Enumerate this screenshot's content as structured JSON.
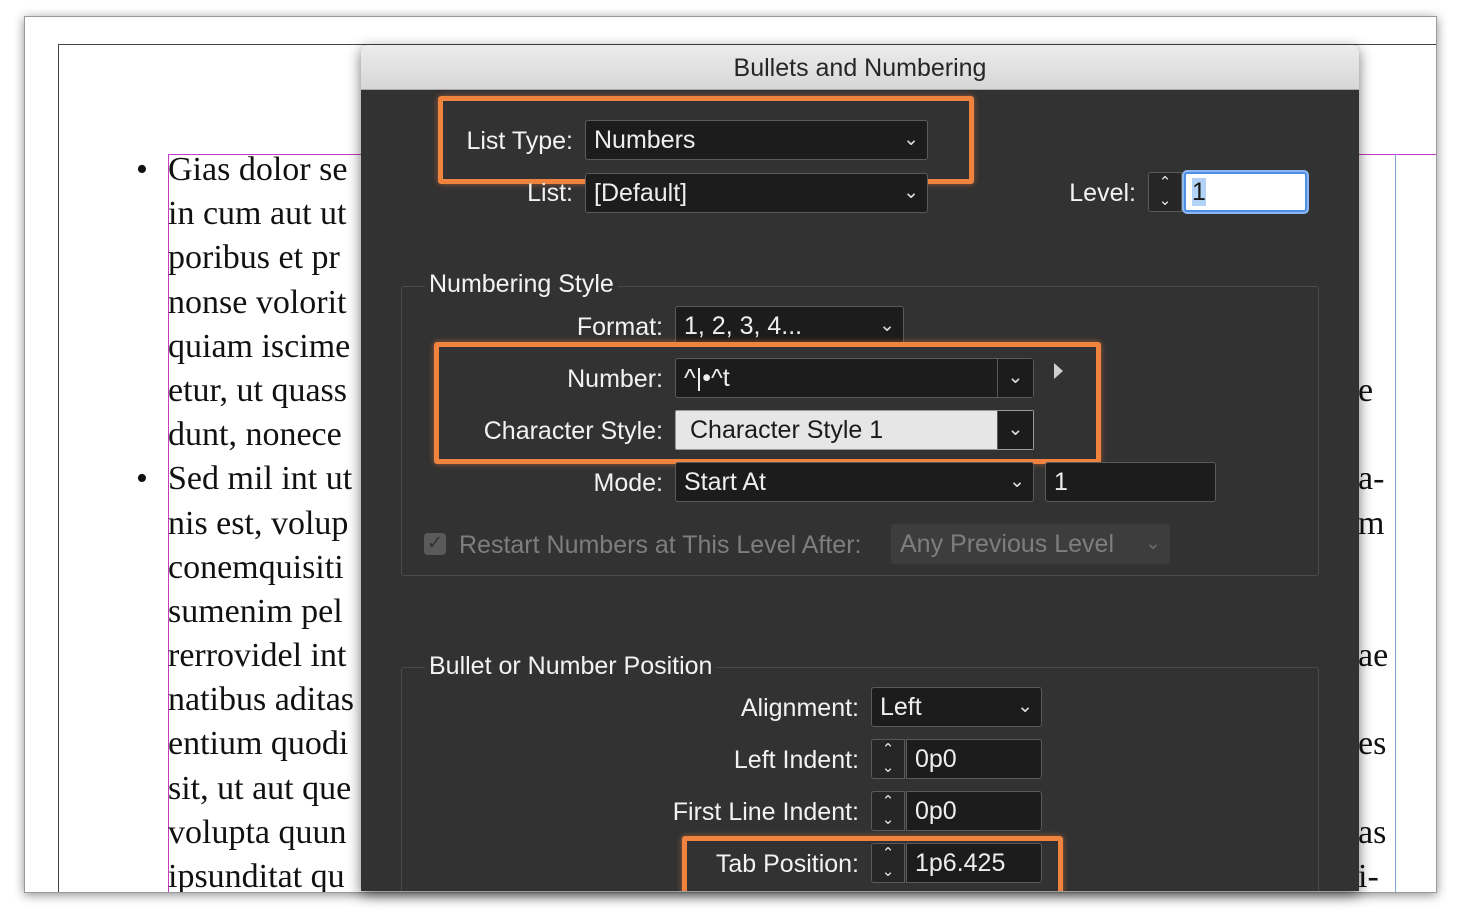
{
  "document": {
    "lines": [
      {
        "bullet": "•",
        "text": "Gias dolor se",
        "right": ""
      },
      {
        "bullet": "",
        "text": "in cum aut ut",
        "right": ""
      },
      {
        "bullet": "",
        "text": "poribus et pr",
        "right": ""
      },
      {
        "bullet": "",
        "text": "nonse volorit",
        "right": ""
      },
      {
        "bullet": "",
        "text": "quiam iscime",
        "right": ""
      },
      {
        "bullet": "",
        "text": "etur, ut quass",
        "right": "e"
      },
      {
        "bullet": "",
        "text": "dunt, nonece",
        "right": ""
      },
      {
        "bullet": "•",
        "text": "Sed mil int ut",
        "right": "a-"
      },
      {
        "bullet": "",
        "text": "nis est, volup",
        "right": "m"
      },
      {
        "bullet": "",
        "text": "conemquisiti",
        "right": ""
      },
      {
        "bullet": "",
        "text": "sumenim pel",
        "right": ""
      },
      {
        "bullet": "",
        "text": "rerrovidel int",
        "right": "ae"
      },
      {
        "bullet": "",
        "text": "natibus aditas",
        "right": ""
      },
      {
        "bullet": "",
        "text": "entium quodi",
        "right": "es"
      },
      {
        "bullet": "",
        "text": "sit, ut aut que",
        "right": ""
      },
      {
        "bullet": "",
        "text": "volupta quun",
        "right": "as"
      },
      {
        "bullet": "",
        "text": "ipsunditat qu",
        "right": "i-"
      }
    ]
  },
  "dialog": {
    "title": "Bullets and Numbering",
    "list_type": {
      "label": "List Type:",
      "value": "Numbers"
    },
    "list": {
      "label": "List:",
      "value": "[Default]"
    },
    "level": {
      "label": "Level:",
      "value": "1"
    },
    "numbering_style": {
      "title": "Numbering Style",
      "format": {
        "label": "Format:",
        "value": "1, 2, 3, 4..."
      },
      "number": {
        "label": "Number:",
        "value": "^|•^t"
      },
      "character_style": {
        "label": "Character Style:",
        "value": "Character Style 1"
      },
      "mode": {
        "label": "Mode:",
        "value": "Start At",
        "start_value": "1"
      },
      "restart": {
        "label": "Restart Numbers at This Level After:",
        "value": "Any Previous Level",
        "checked": true
      }
    },
    "position": {
      "title": "Bullet or Number Position",
      "alignment": {
        "label": "Alignment:",
        "value": "Left"
      },
      "left_indent": {
        "label": "Left Indent:",
        "value": "0p0"
      },
      "first_line_indent": {
        "label": "First Line Indent:",
        "value": "0p0"
      },
      "tab_position": {
        "label": "Tab Position:",
        "value": "1p6.425"
      }
    }
  },
  "colors": {
    "highlight": "#f0843f",
    "dialog_bg": "#323232",
    "focus": "#4d90e4"
  },
  "icons": {
    "dropdown": "chevron-down-icon",
    "stepper": "stepper-icon",
    "flyout": "triangle-right-icon"
  }
}
